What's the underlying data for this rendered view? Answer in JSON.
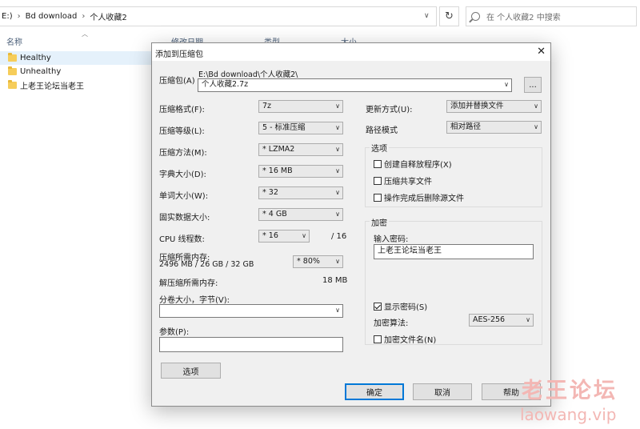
{
  "explorer": {
    "breadcrumbs": [
      "E:)",
      "Bd download",
      "个人收藏2"
    ],
    "search_placeholder": "在 个人收藏2 中搜索",
    "columns": {
      "name": "名称",
      "modified": "修改日期",
      "type": "类型",
      "size": "大小"
    },
    "files": [
      "Healthy",
      "Unhealthy",
      "上老王论坛当老王"
    ]
  },
  "dialog": {
    "title": "添加到压缩包",
    "archive_label": "压缩包(A)",
    "archive_path": "E:\\Bd download\\个人收藏2\\",
    "archive_name": "个人收藏2.7z",
    "browse_label": "...",
    "format_label": "压缩格式(F):",
    "format_value": "7z",
    "level_label": "压缩等级(L):",
    "level_value": "5 - 标准压缩",
    "method_label": "压缩方法(M):",
    "method_value": "* LZMA2",
    "dict_label": "字典大小(D):",
    "dict_value": "* 16 MB",
    "word_label": "单词大小(W):",
    "word_value": "* 32",
    "solid_label": "固实数据大小:",
    "solid_value": "* 4 GB",
    "cpu_label": "CPU 线程数:",
    "cpu_value": "* 16",
    "cpu_total": "/ 16",
    "mem_label": "压缩所需内存:",
    "mem_value": "2496 MB / 26 GB / 32 GB",
    "mem_percent": "* 80%",
    "decomp_label": "解压缩所需内存:",
    "decomp_value": "18 MB",
    "split_label": "分卷大小，字节(V):",
    "split_value": "",
    "params_label": "参数(P):",
    "params_value": "",
    "options_button": "选项",
    "update_label": "更新方式(U):",
    "update_value": "添加并替换文件",
    "path_label": "路径模式",
    "path_value": "相对路径",
    "options_group": {
      "title": "选项",
      "items": [
        {
          "label": "创建自释放程序(X)",
          "checked": false
        },
        {
          "label": "压缩共享文件",
          "checked": false
        },
        {
          "label": "操作完成后删除源文件",
          "checked": false
        }
      ]
    },
    "encryption": {
      "title": "加密",
      "password_label": "输入密码:",
      "password_value": "上老王论坛当老王",
      "show_password_label": "显示密码(S)",
      "show_password_checked": true,
      "method_label": "加密算法:",
      "method_value": "AES-256",
      "encrypt_names_label": "加密文件名(N)",
      "encrypt_names_checked": false
    },
    "ok_label": "确定",
    "cancel_label": "取消",
    "help_label": "帮助"
  },
  "watermark": {
    "line1": "老王论坛",
    "line2": "laowang.vip"
  }
}
